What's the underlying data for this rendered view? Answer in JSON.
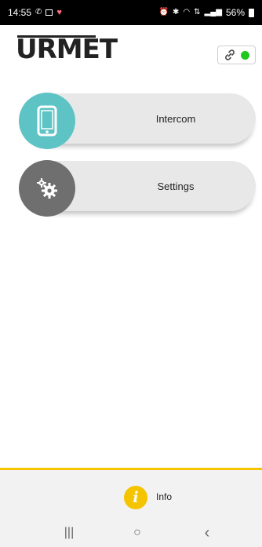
{
  "status_bar": {
    "time": "14:55",
    "battery_percent": "56%",
    "icons": [
      "notification-icon",
      "gallery-icon",
      "heart-icon",
      "alarm-icon",
      "bluetooth-icon",
      "wifi-icon",
      "mobile-data-icon",
      "signal-icon",
      "battery-icon"
    ]
  },
  "header": {
    "logo_text": "URMET",
    "connection_status": "connected",
    "connection_color": "#1fc81f"
  },
  "menu": {
    "items": [
      {
        "label": "Intercom",
        "icon": "phone-icon",
        "color": "#5ec3c4"
      },
      {
        "label": "Settings",
        "icon": "gears-icon",
        "color": "#6f6f6f"
      }
    ]
  },
  "footer": {
    "info_label": "Info",
    "accent_color": "#f5c400"
  },
  "navbar": {
    "recents": "|||",
    "home": "○",
    "back": "‹"
  }
}
